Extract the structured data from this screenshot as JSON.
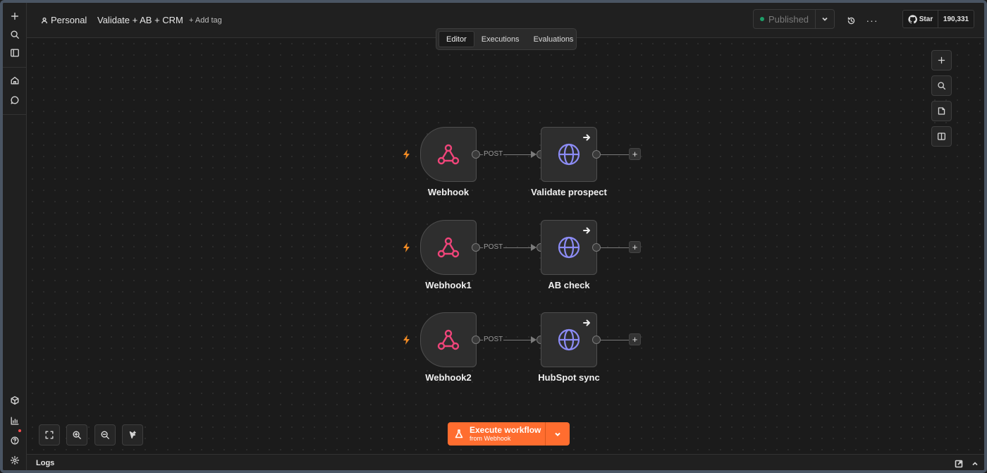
{
  "header": {
    "project": "Personal",
    "workflow_name": "Validate + AB + CRM",
    "add_tag": "+ Add tag",
    "status": "Published",
    "github_star": "Star",
    "github_count": "190,331"
  },
  "tabs": [
    {
      "label": "Editor",
      "active": true
    },
    {
      "label": "Executions",
      "active": false
    },
    {
      "label": "Evaluations",
      "active": false
    }
  ],
  "workflow": {
    "rows": [
      {
        "trigger": "Webhook",
        "method": "POST",
        "action": "Validate prospect"
      },
      {
        "trigger": "Webhook1",
        "method": "POST",
        "action": "AB check"
      },
      {
        "trigger": "Webhook2",
        "method": "POST",
        "action": "HubSpot sync"
      }
    ]
  },
  "execute": {
    "label": "Execute workflow",
    "sublabel": "from Webhook"
  },
  "logs": {
    "label": "Logs"
  },
  "colors": {
    "accent": "#ff6d2f",
    "webhook_icon": "#f0457a",
    "http_icon": "#8c8cf5",
    "published_dot": "#1d9e68",
    "trigger_bolt": "#f08a24"
  },
  "icons": {
    "trigger_node": "webhook-icon",
    "action_node": "globe-icon",
    "rail_top": [
      "plus-icon",
      "search-icon",
      "sidebar-icon",
      "home-icon",
      "chat-icon"
    ],
    "rail_bottom": [
      "templates-icon",
      "insights-icon",
      "help-icon",
      "settings-icon"
    ],
    "canvas_right": [
      "plus-icon",
      "search-icon",
      "sticky-note-icon",
      "panel-icon"
    ],
    "canvas_bottom": [
      "fit-view-icon",
      "zoom-in-icon",
      "zoom-out-icon",
      "tidy-up-icon"
    ]
  }
}
